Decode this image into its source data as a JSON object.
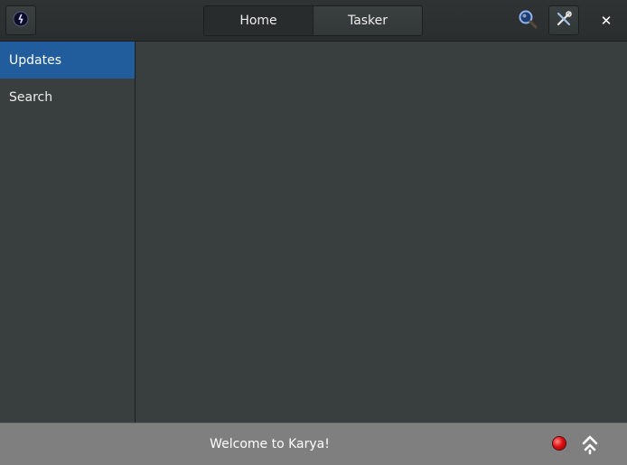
{
  "header": {
    "app_icon": "karya-app-icon",
    "tabs": [
      {
        "label": "Home",
        "active": true
      },
      {
        "label": "Tasker",
        "active": false
      }
    ],
    "search_icon": "search-icon",
    "tools_icon": "tools-icon",
    "close_label": "✕"
  },
  "sidebar": {
    "items": [
      {
        "label": "Updates",
        "selected": true
      },
      {
        "label": "Search",
        "selected": false
      }
    ]
  },
  "statusbar": {
    "message": "Welcome to Karya!",
    "record_icon": "record-indicator-icon",
    "upload_icon": "upload-icon"
  },
  "colors": {
    "accent": "#215d9c",
    "background": "#393f3f",
    "statusbar": "#7f7f7f"
  }
}
